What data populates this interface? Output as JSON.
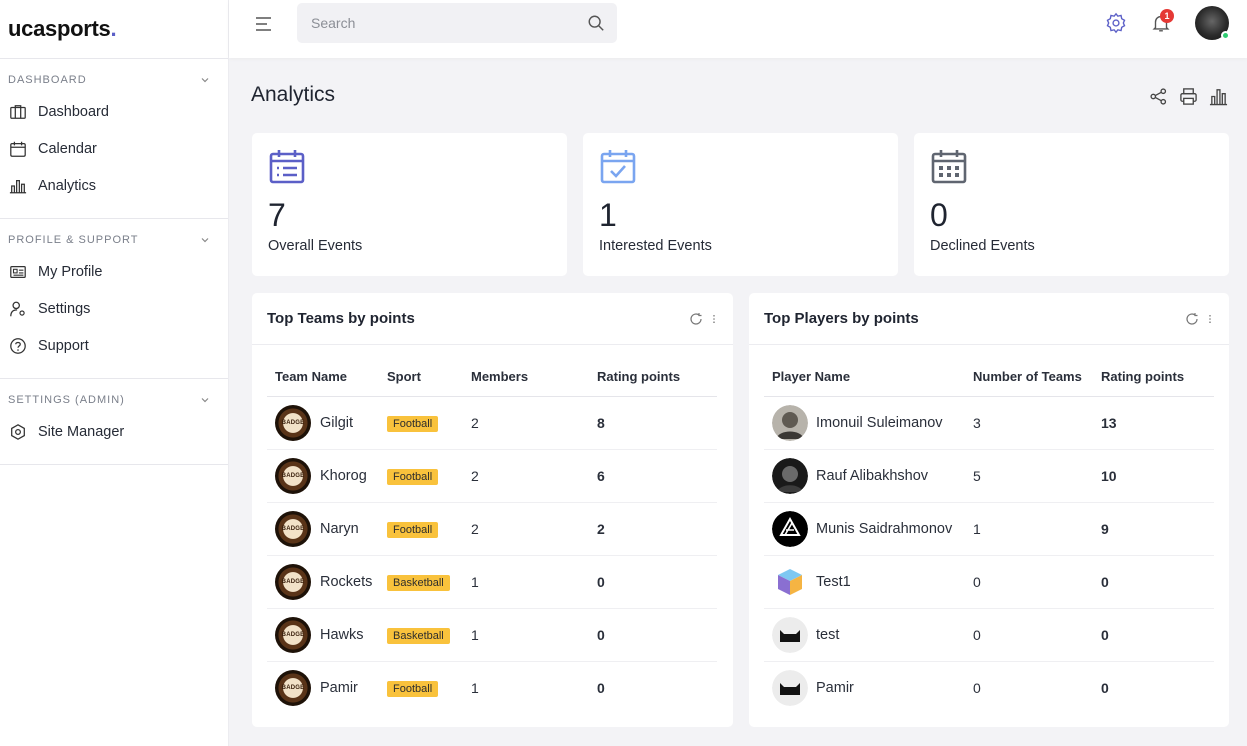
{
  "app": {
    "logo_text": "ucasports",
    "logo_dot": "."
  },
  "sidebar": {
    "sections": [
      {
        "title": "DASHBOARD",
        "items": [
          {
            "label": "Dashboard",
            "icon": "dashboard-icon"
          },
          {
            "label": "Calendar",
            "icon": "calendar-icon"
          },
          {
            "label": "Analytics",
            "icon": "analytics-icon"
          }
        ]
      },
      {
        "title": "PROFILE & SUPPORT",
        "items": [
          {
            "label": "My Profile",
            "icon": "profile-icon"
          },
          {
            "label": "Settings",
            "icon": "user-settings-icon"
          },
          {
            "label": "Support",
            "icon": "help-icon"
          }
        ]
      },
      {
        "title": "SETTINGS (ADMIN)",
        "items": [
          {
            "label": "Site Manager",
            "icon": "site-manager-icon"
          }
        ]
      }
    ]
  },
  "topbar": {
    "search_placeholder": "Search",
    "notification_count": "1"
  },
  "page": {
    "title": "Analytics"
  },
  "stats": [
    {
      "value": "7",
      "label": "Overall Events",
      "color": "#5b5fc7"
    },
    {
      "value": "1",
      "label": "Interested Events",
      "color": "#7aa5f0"
    },
    {
      "value": "0",
      "label": "Declined Events",
      "color": "#5f6570"
    }
  ],
  "teams_card": {
    "title": "Top Teams by points",
    "columns": [
      "Team Name",
      "Sport",
      "Members",
      "Rating points"
    ],
    "logo_text": "BADGE",
    "rows": [
      {
        "name": "Gilgit",
        "sport": "Football",
        "members": "2",
        "points": "8"
      },
      {
        "name": "Khorog",
        "sport": "Football",
        "members": "2",
        "points": "6"
      },
      {
        "name": "Naryn",
        "sport": "Football",
        "members": "2",
        "points": "2"
      },
      {
        "name": "Rockets",
        "sport": "Basketball",
        "members": "1",
        "points": "0"
      },
      {
        "name": "Hawks",
        "sport": "Basketball",
        "members": "1",
        "points": "0"
      },
      {
        "name": "Pamir",
        "sport": "Football",
        "members": "1",
        "points": "0"
      }
    ]
  },
  "players_card": {
    "title": "Top Players by points",
    "columns": [
      "Player Name",
      "Number of Teams",
      "Rating points"
    ],
    "rows": [
      {
        "name": "Imonuil Suleimanov",
        "teams": "3",
        "points": "13",
        "avatar": "photo-gray"
      },
      {
        "name": "Rauf Alibakhshov",
        "teams": "5",
        "points": "10",
        "avatar": "photo-dark"
      },
      {
        "name": "Munis Saidrahmonov",
        "teams": "1",
        "points": "9",
        "avatar": "logo-black"
      },
      {
        "name": "Test1",
        "teams": "0",
        "points": "0",
        "avatar": "cube-logo"
      },
      {
        "name": "test",
        "teams": "0",
        "points": "0",
        "avatar": "cat-placeholder"
      },
      {
        "name": "Pamir",
        "teams": "0",
        "points": "0",
        "avatar": "cat-placeholder"
      }
    ]
  }
}
